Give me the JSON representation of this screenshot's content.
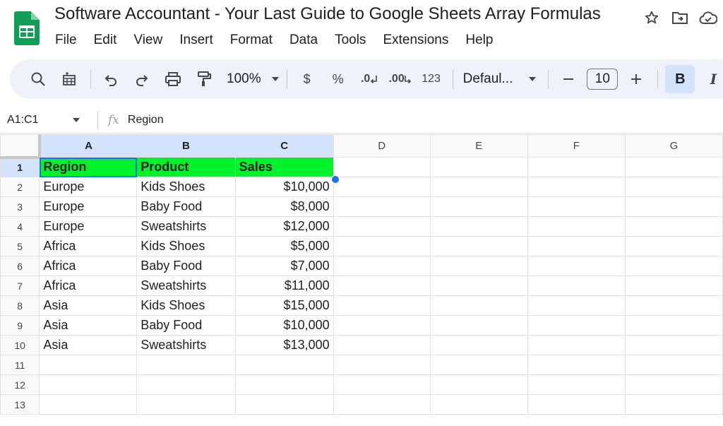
{
  "app": {
    "title": "Software Accountant - Your Last Guide to Google Sheets Array Formulas",
    "brand_color": "#0f9d58"
  },
  "menu": [
    "File",
    "Edit",
    "View",
    "Insert",
    "Format",
    "Data",
    "Tools",
    "Extensions",
    "Help"
  ],
  "toolbar": {
    "zoom": "100%",
    "currency": "$",
    "percent": "%",
    "decrease_decimal": ".0",
    "increase_decimal": ".00",
    "number_format": "123",
    "font": "Defaul...",
    "font_size": "10",
    "bold": "B",
    "italic": "I"
  },
  "formula_bar": {
    "name_box": "A1:C1",
    "fx": "fx",
    "value": "Region"
  },
  "grid": {
    "columns": [
      "A",
      "B",
      "C",
      "D",
      "E",
      "F",
      "G"
    ],
    "rows": [
      [
        "Region",
        "Product",
        "Sales"
      ],
      [
        "Europe",
        "Kids Shoes",
        "$10,000"
      ],
      [
        "Europe",
        "Baby Food",
        "$8,000"
      ],
      [
        "Europe",
        "Sweatshirts",
        "$12,000"
      ],
      [
        "Africa",
        "Kids Shoes",
        "$5,000"
      ],
      [
        "Africa",
        "Baby Food",
        "$7,000"
      ],
      [
        "Africa",
        "Sweatshirts",
        "$11,000"
      ],
      [
        "Asia",
        "Kids Shoes",
        "$15,000"
      ],
      [
        "Asia",
        "Baby Food",
        "$10,000"
      ],
      [
        "Asia",
        "Sweatshirts",
        "$13,000"
      ],
      [
        "",
        "",
        ""
      ],
      [
        "",
        "",
        ""
      ],
      [
        "",
        "",
        ""
      ]
    ],
    "header_fill": "#00f22a",
    "selection_color": "#1a73e8"
  }
}
